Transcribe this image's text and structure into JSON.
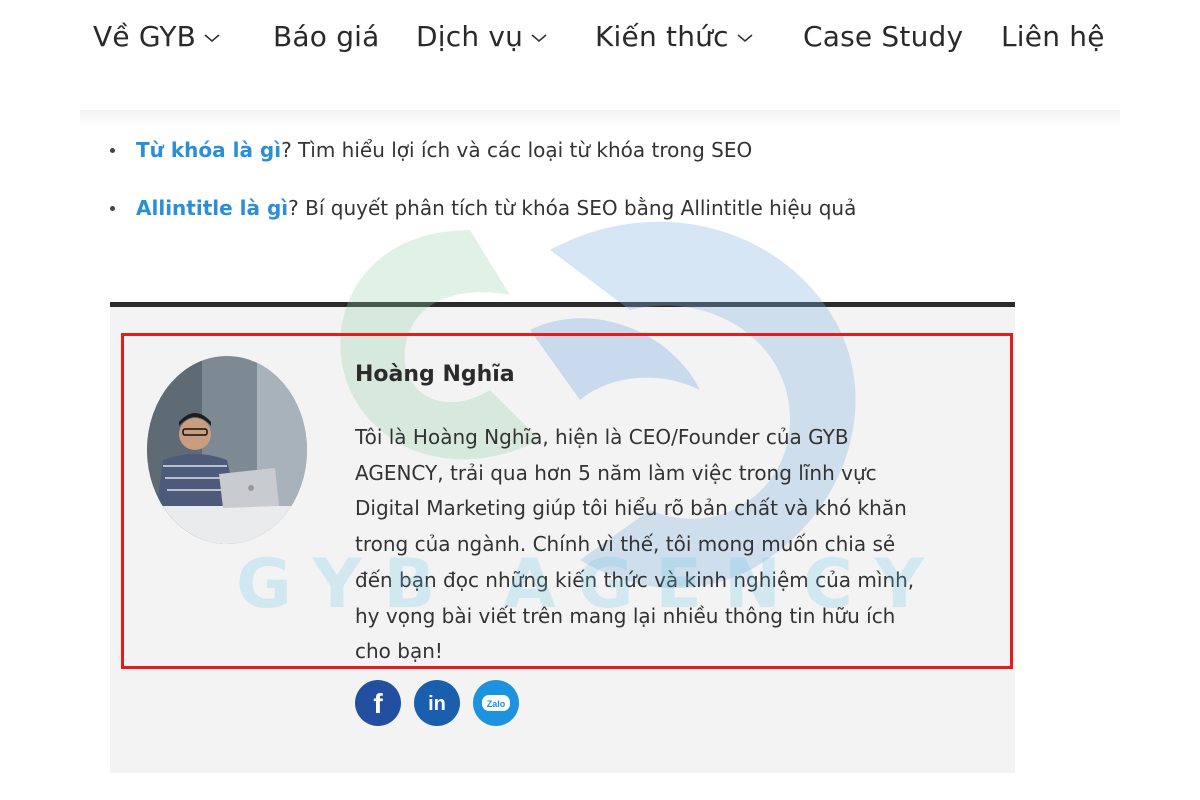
{
  "nav": {
    "items": [
      {
        "label": "Về GYB",
        "has_dropdown": true
      },
      {
        "label": "Báo giá",
        "has_dropdown": false
      },
      {
        "label": "Dịch vụ",
        "has_dropdown": true
      },
      {
        "label": "Kiến thức",
        "has_dropdown": true
      },
      {
        "label": "Case Study",
        "has_dropdown": false
      },
      {
        "label": "Liên hệ",
        "has_dropdown": false
      }
    ]
  },
  "related": [
    {
      "link": "Từ khóa là gì",
      "rest": "? Tìm hiểu lợi ích và các loại từ khóa trong SEO"
    },
    {
      "link": "Allintitle là gì",
      "rest": "? Bí quyết phân tích từ khóa SEO bằng Allintitle hiệu quả"
    }
  ],
  "watermark": {
    "text": "GYB AGENCY"
  },
  "author": {
    "name": "Hoàng Nghĩa",
    "bio_lines": [
      "Tôi là Hoàng Nghĩa, hiện là CEO/Founder của GYB",
      "AGENCY, trải qua hơn 5 năm làm việc trong lĩnh vực",
      "Digital Marketing giúp tôi hiểu rõ bản chất và khó khăn",
      "trong của ngành. Chính vì thế, tôi mong muốn chia sẻ",
      "đến bạn đọc những kiến thức và kinh nghiệm của mình,",
      "hy vọng bài viết trên mang lại nhiều thông tin hữu ích",
      "cho bạn!"
    ],
    "socials": [
      {
        "icon": "facebook-icon",
        "glyph": "f",
        "color": "#234fa0"
      },
      {
        "icon": "linkedin-icon",
        "glyph": "in",
        "color": "#1a5fae"
      },
      {
        "icon": "zalo-icon",
        "glyph": "Zalo",
        "color": "#1d93e0"
      }
    ]
  },
  "colors": {
    "link": "#2b8fd6",
    "highlight_border": "#e31d1d",
    "rule": "#2b2b2b",
    "box_bg": "#f3f3f3"
  }
}
